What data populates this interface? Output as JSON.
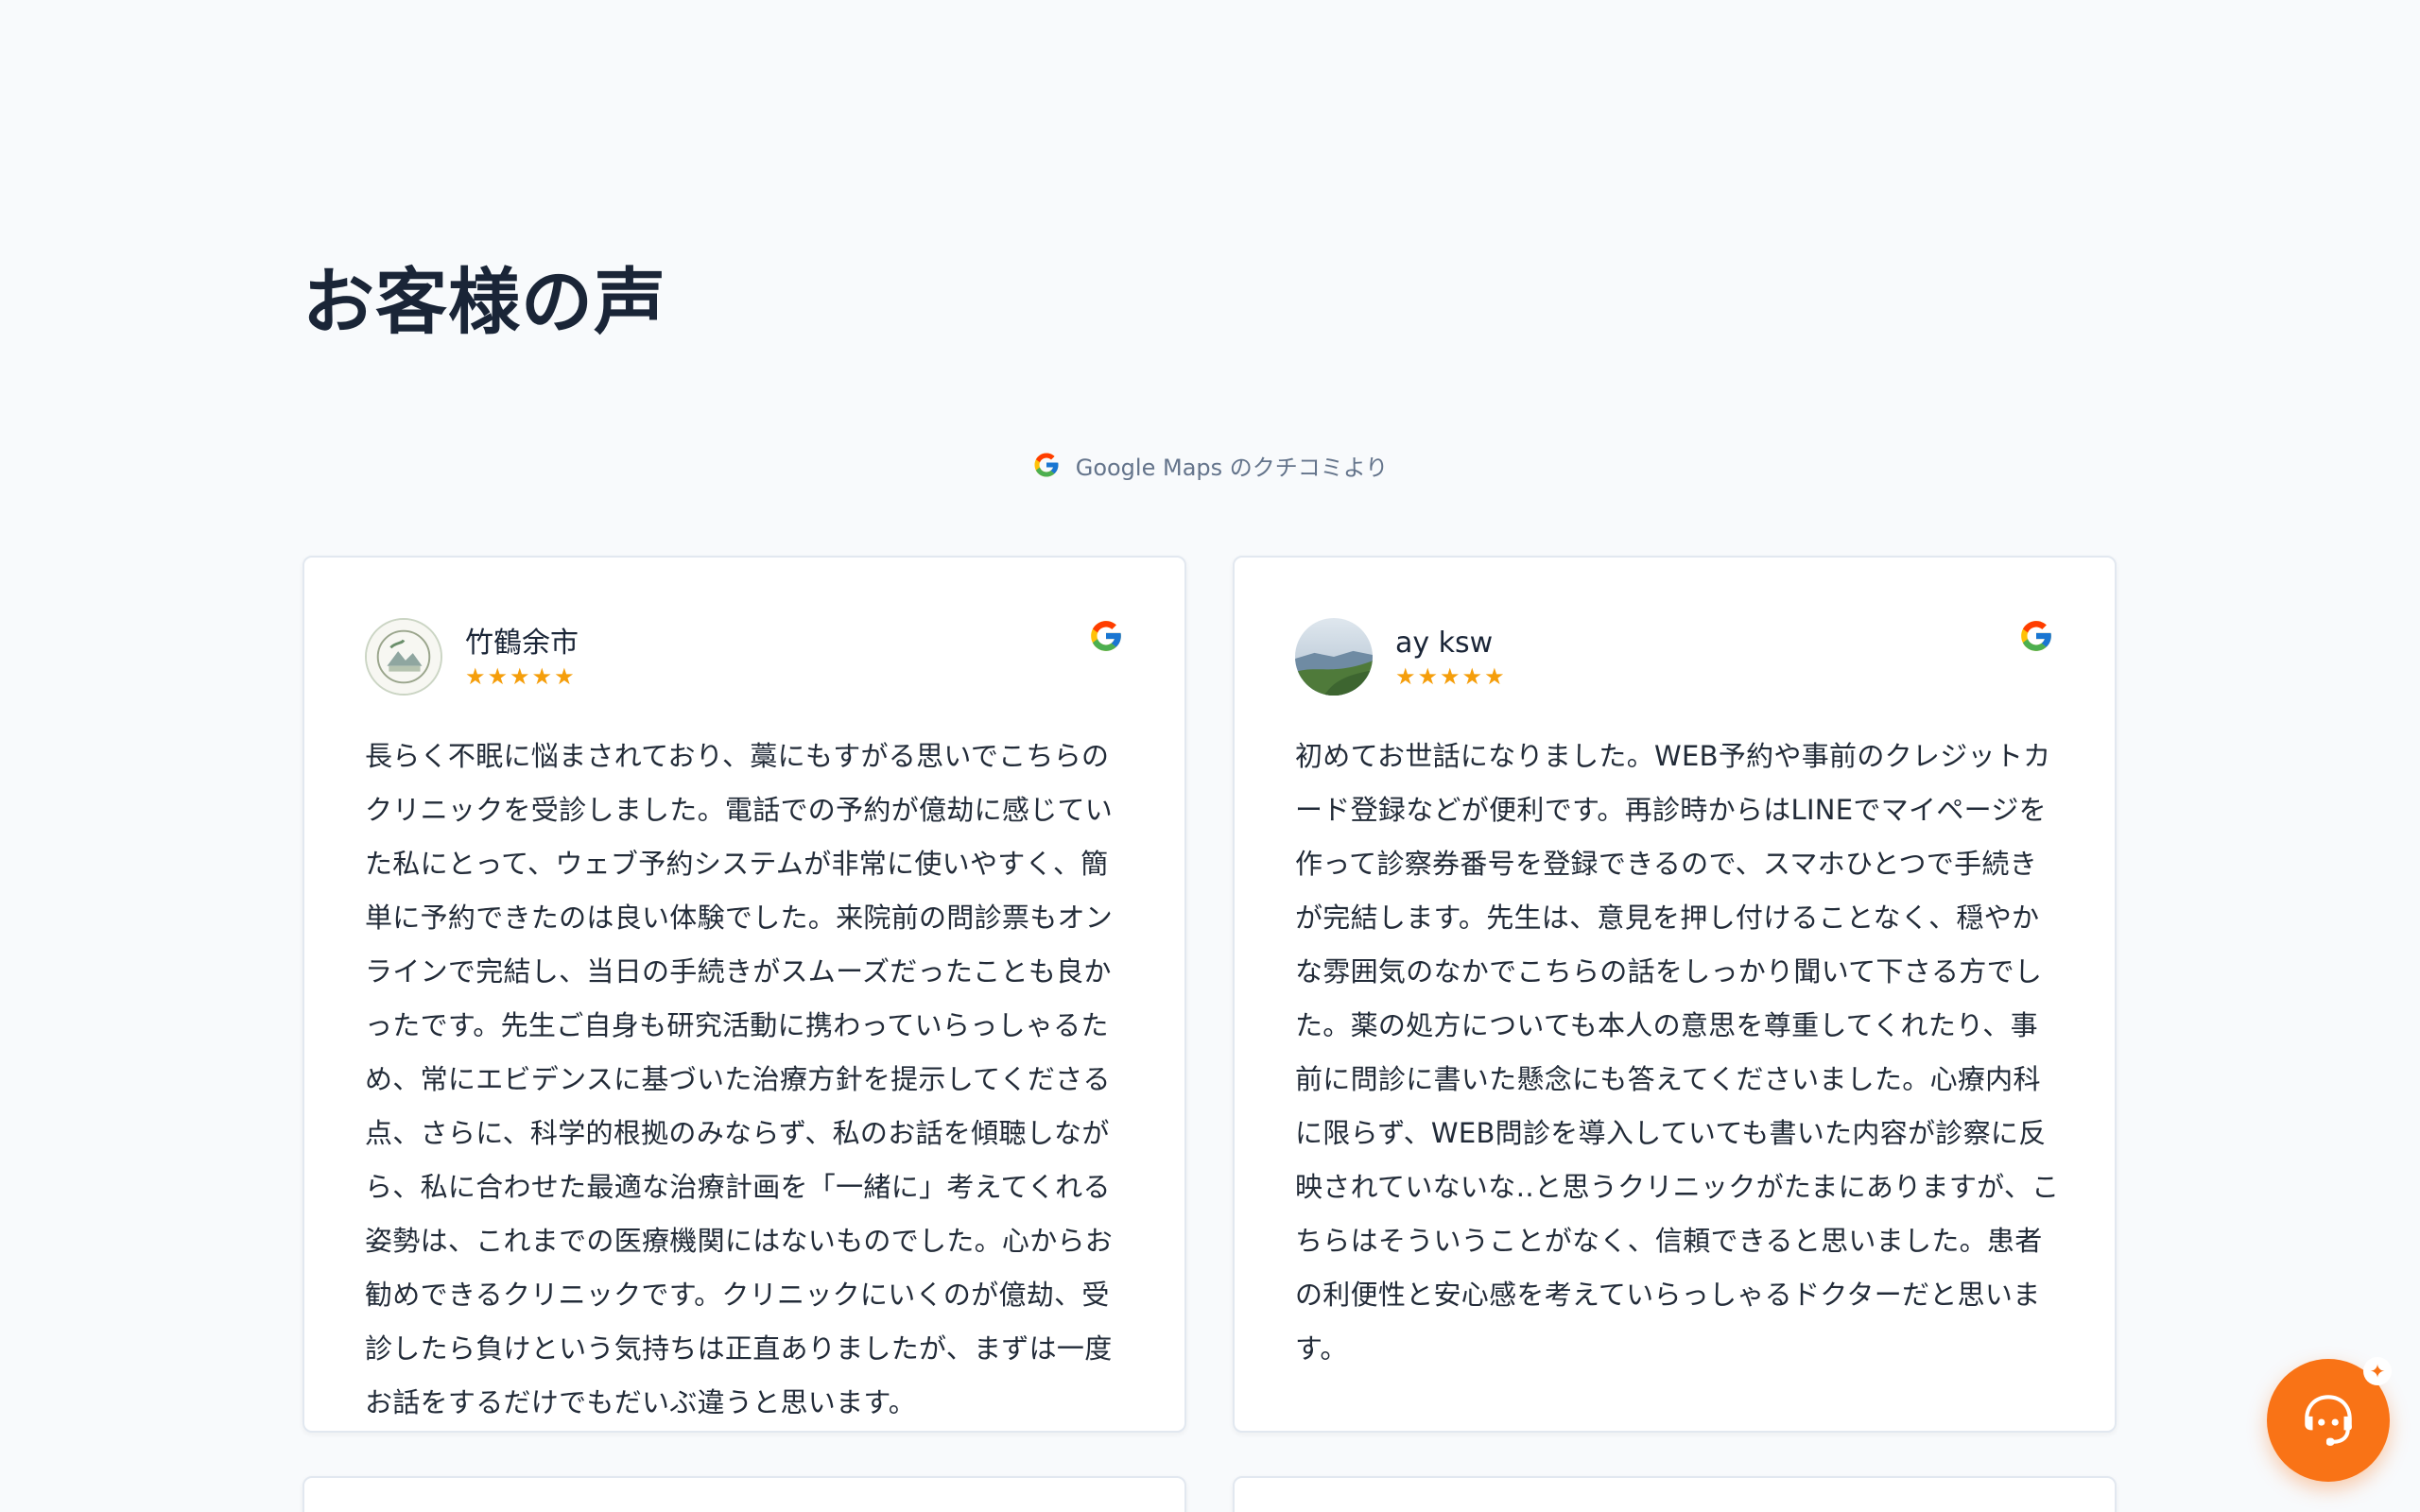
{
  "section": {
    "title": "お客様の声",
    "source_text": "Google Maps のクチコミより",
    "source_icon": "google-g-icon"
  },
  "reviews": [
    {
      "name": "竹鶴余市",
      "stars": "★★★★★",
      "rating": 5,
      "text": "長らく不眠に悩まされており、藁にもすがる思いでこちらのクリニックを受診しました。電話での予約が億劫に感じていた私にとって、ウェブ予約システムが非常に使いやすく、簡単に予約できたのは良い体験でした。来院前の問診票もオンラインで完結し、当日の手続きがスムーズだったことも良かったです。先生ご自身も研究活動に携わっていらっしゃるため、常にエビデンスに基づいた治療方針を提示してくださる点、さらに、科学的根拠のみならず、私のお話を傾聴しながら、私に合わせた最適な治療計画を「一緒に」考えてくれる姿勢は、これまでの医療機関にはないものでした。心からお勧めできるクリニックです。クリニックにいくのが億劫、受診したら負けという気持ちは正直ありましたが、まずは一度お話をするだけでもだいぶ違うと思います。"
    },
    {
      "name": "ay ksw",
      "stars": "★★★★★",
      "rating": 5,
      "text": "初めてお世話になりました。WEB予約や事前のクレジットカード登録などが便利です。再診時からはLINEでマイページを作って診察券番号を登録できるので、スマホひとつで手続きが完結します。先生は、意見を押し付けることなく、穏やかな雰囲気のなかでこちらの話をしっかり聞いて下さる方でした。薬の処方についても本人の意思を尊重してくれたり、事前に問診に書いた懸念にも答えてくださいました。心療内科に限らず、WEB問診を導入していても書いた内容が診察に反映されていないな‥と思うクリニックがたまにありますが、こちらはそういうことがなく、信頼できると思いました。患者の利便性と安心感を考えていらっしゃるドクターだと思います。"
    }
  ],
  "chat": {
    "icon": "chat-support-icon",
    "badge": "✦"
  },
  "colors": {
    "background": "#f8fafc",
    "title": "#1a2537",
    "star": "#f59e0b",
    "fab": "#f97316",
    "card_border": "#e2e8f0"
  }
}
